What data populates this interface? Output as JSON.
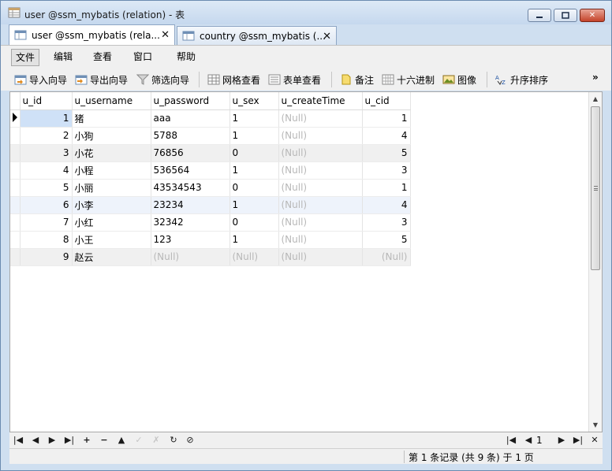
{
  "window": {
    "title": "user @ssm_mybatis (relation) - 表",
    "buttons": {
      "minimize": "▭",
      "maximize": "□",
      "close": "✕"
    }
  },
  "tabs": [
    {
      "label": "user @ssm_mybatis (rela...",
      "close": "✕",
      "active": true
    },
    {
      "label": "country @ssm_mybatis (...",
      "close": "✕",
      "active": false
    }
  ],
  "menu": [
    "文件",
    "编辑",
    "查看",
    "窗口",
    "帮助"
  ],
  "toolbar": {
    "import": "导入向导",
    "export": "导出向导",
    "filter": "筛选向导",
    "grid_view": "网格查看",
    "form_view": "表单查看",
    "memo": "备注",
    "hex": "十六进制",
    "image": "图像",
    "sort": "升序排序",
    "overflow": "»"
  },
  "grid": {
    "columns": [
      "u_id",
      "u_username",
      "u_password",
      "u_sex",
      "u_createTime",
      "u_cid"
    ],
    "rows": [
      [
        "1",
        "猪",
        "aaa",
        "1",
        "(Null)",
        "1"
      ],
      [
        "2",
        "小狗",
        "5788",
        "1",
        "(Null)",
        "4"
      ],
      [
        "3",
        "小花",
        "76856",
        "0",
        "(Null)",
        "5"
      ],
      [
        "4",
        "小程",
        "536564",
        "1",
        "(Null)",
        "3"
      ],
      [
        "5",
        "小丽",
        "43534543",
        "0",
        "(Null)",
        "1"
      ],
      [
        "6",
        "小李",
        "23234",
        "1",
        "(Null)",
        "4"
      ],
      [
        "7",
        "小红",
        "32342",
        "0",
        "(Null)",
        "3"
      ],
      [
        "8",
        "小王",
        "123",
        "1",
        "(Null)",
        "5"
      ],
      [
        "9",
        "赵云",
        "(Null)",
        "(Null)",
        "(Null)",
        "(Null)"
      ]
    ]
  },
  "navbar": {
    "buttons": [
      "first-record",
      "prev-record",
      "next-record",
      "last-record",
      "add",
      "delete",
      "up",
      "apply",
      "cancel",
      "refresh",
      "stop"
    ],
    "page": "1"
  },
  "status": {
    "text": "第 1 条记录 (共 9 条) 于 1 页"
  }
}
